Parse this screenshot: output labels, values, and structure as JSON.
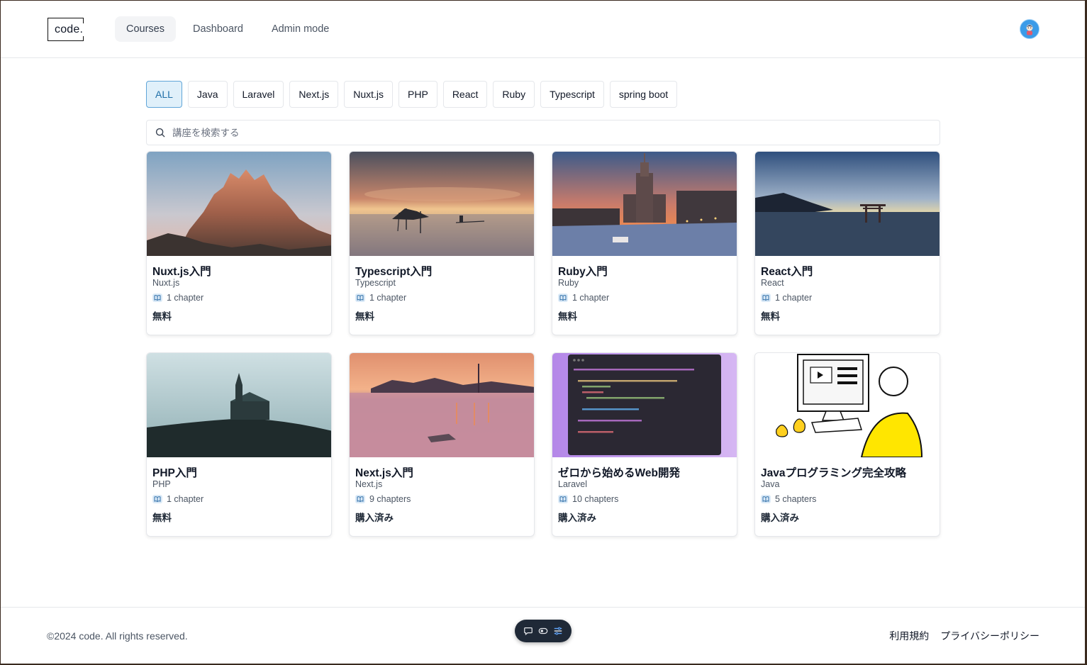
{
  "header": {
    "logo": "code.",
    "nav": [
      {
        "label": "Courses",
        "active": true
      },
      {
        "label": "Dashboard",
        "active": false
      },
      {
        "label": "Admin mode",
        "active": false
      }
    ]
  },
  "filters": [
    "ALL",
    "Java",
    "Laravel",
    "Next.js",
    "Nuxt.js",
    "PHP",
    "React",
    "Ruby",
    "Typescript",
    "spring boot"
  ],
  "active_filter": "ALL",
  "search": {
    "placeholder": "講座を検索する",
    "value": ""
  },
  "courses": [
    {
      "title": "Nuxt.js入門",
      "category": "Nuxt.js",
      "chapters": "1 chapter",
      "price": "無料",
      "thumb": "mountain"
    },
    {
      "title": "Typescript入門",
      "category": "Typescript",
      "chapters": "1 chapter",
      "price": "無料",
      "thumb": "lake-sunset"
    },
    {
      "title": "Ruby入門",
      "category": "Ruby",
      "chapters": "1 chapter",
      "price": "無料",
      "thumb": "city-river"
    },
    {
      "title": "React入門",
      "category": "React",
      "chapters": "1 chapter",
      "price": "無料",
      "thumb": "torii-sea"
    },
    {
      "title": "PHP入門",
      "category": "PHP",
      "chapters": "1 chapter",
      "price": "無料",
      "thumb": "church-hill"
    },
    {
      "title": "Next.js入門",
      "category": "Next.js",
      "chapters": "9 chapters",
      "price": "購入済み",
      "thumb": "pink-lake"
    },
    {
      "title": "ゼロから始めるWeb開発",
      "category": "Laravel",
      "chapters": "10 chapters",
      "price": "購入済み",
      "thumb": "code-editor"
    },
    {
      "title": "Javaプログラミング完全攻略",
      "category": "Java",
      "chapters": "5 chapters",
      "price": "購入済み",
      "thumb": "illustration"
    }
  ],
  "footer": {
    "copyright": "©2024 code. All rights reserved.",
    "links": [
      "利用規約",
      "プライバシーポリシー"
    ]
  },
  "colors": {
    "accent": "#1f6fa8",
    "active_chip_bg": "#e0f0fa",
    "avatar": "#3b9be8"
  }
}
